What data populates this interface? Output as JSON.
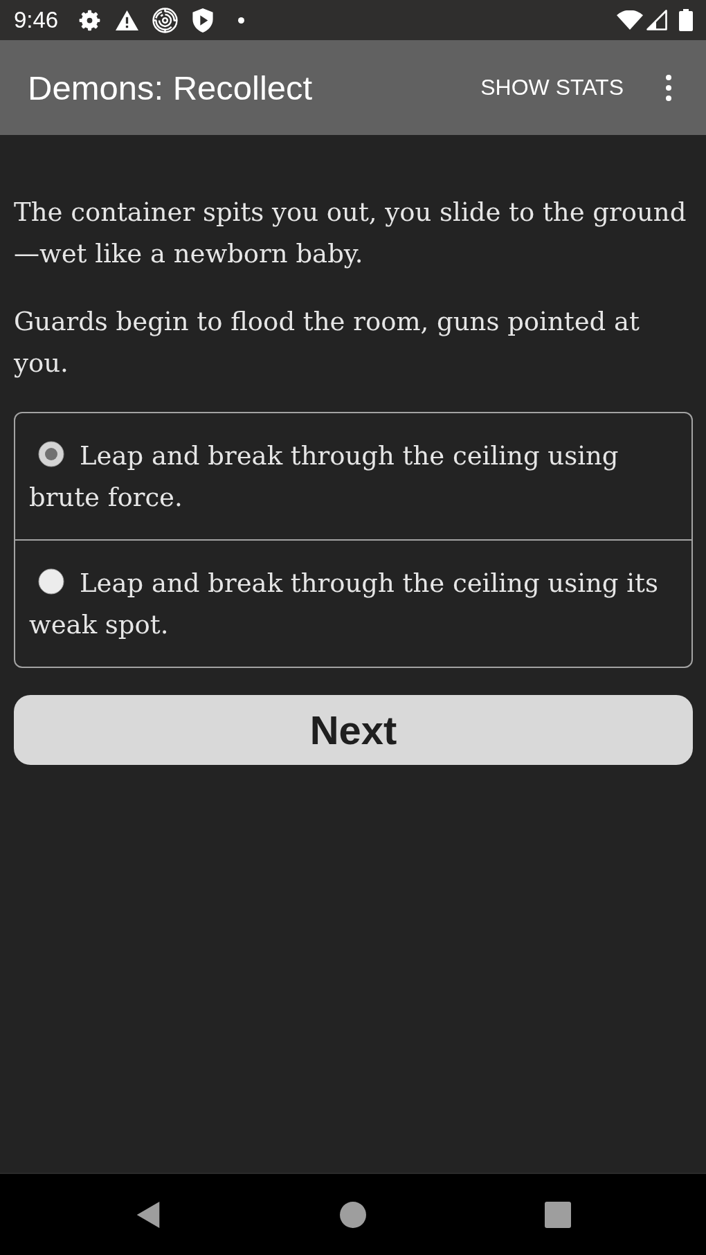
{
  "status_bar": {
    "time": "9:46"
  },
  "app_bar": {
    "title": "Demons: Recollect",
    "actions": [
      "SHOW STATS"
    ]
  },
  "story": {
    "paragraphs": [
      "The container spits you out, you slide to the ground—wet like a newborn baby.",
      "Guards begin to flood the room, guns pointed at you."
    ]
  },
  "choices": [
    {
      "text": "Leap and break through the ceiling using brute force.",
      "selected": true
    },
    {
      "text": "Leap and break through the ceiling using its weak spot.",
      "selected": false
    }
  ],
  "next_button": {
    "label": "Next"
  }
}
